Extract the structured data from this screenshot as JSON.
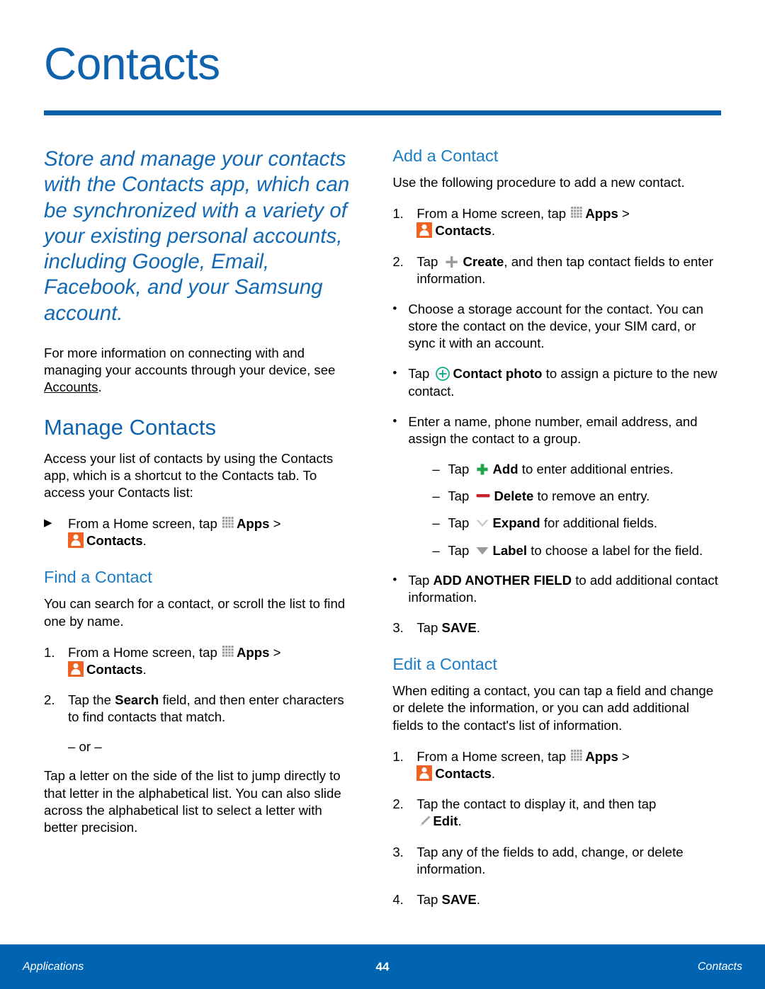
{
  "page_title": "Contacts",
  "colors": {
    "heading_blue": "#0F62AC",
    "rule_blue": "#0B5FAA",
    "subheading_blue": "#1B7CC4",
    "lead_blue": "#1268B3",
    "footer_blue": "#0064B0",
    "contacts_icon_orange": "#EE6324",
    "add_icon_green": "#21A349",
    "delete_icon_red": "#C8232C",
    "contact_photo_teal": "#16A88C",
    "icon_grey": "#9A9A9A"
  },
  "lead": "Store and manage your contacts with the Contacts app, which can be synchronized with a variety of your existing personal accounts, including Google, Email, Facebook, and your Samsung account.",
  "intro": {
    "text_before_link": "For more information on connecting with and managing your accounts through your device, see ",
    "link": "Accounts",
    "text_after_link": "."
  },
  "left_column": {
    "manage": {
      "heading": "Manage Contacts",
      "body": "Access your list of contacts by using the Contacts app, which is a shortcut to the Contacts tab. To access your Contacts list:",
      "step_arrow": "▶",
      "step_text_1": "From a Home screen, tap ",
      "apps_label": "Apps",
      "chevron": " > ",
      "contacts_label": "Contacts",
      "period": "."
    },
    "find": {
      "heading": "Find a Contact",
      "body": "You can search for a contact, or scroll the list to find one by name.",
      "steps": [
        {
          "num": "1.",
          "pre": "From a Home screen, tap ",
          "apps_label": "Apps",
          "chevron": " > ",
          "contacts_label": "Contacts",
          "post": "."
        },
        {
          "num": "2.",
          "pre": "Tap the ",
          "bold": "Search",
          "post": " field, and then enter characters to find contacts that match."
        }
      ],
      "or_separator": "– or –",
      "alt_text": "Tap a letter on the side of the list to jump directly to that letter in the alphabetical list. You can also slide across the alphabetical list to select a letter with better precision."
    }
  },
  "right_column": {
    "add": {
      "heading": "Add a Contact",
      "body": "Use the following procedure to add a new contact.",
      "step1": {
        "num": "1.",
        "pre": "From a Home screen, tap ",
        "apps_label": "Apps",
        "chevron": " > ",
        "contacts_label": "Contacts",
        "post": "."
      },
      "step2": {
        "num": "2.",
        "pre": "Tap ",
        "bold": "Create",
        "post": ", and then tap contact fields to enter information."
      },
      "bullets": [
        {
          "text": "Choose a storage account for the contact. You can store the contact on the device, your SIM card, or sync it with an account."
        },
        {
          "pre": "Tap ",
          "bold": "Contact photo",
          "post": " to assign a picture to the new contact."
        },
        {
          "text": "Enter a name, phone number, email address, and assign the contact to a group."
        }
      ],
      "dashes": [
        {
          "pre": "Tap ",
          "bold": "Add",
          "post": " to enter additional entries."
        },
        {
          "pre": "Tap ",
          "bold": "Delete",
          "post": " to remove an entry."
        },
        {
          "pre": "Tap ",
          "bold": "Expand",
          "post": " for additional fields."
        },
        {
          "pre": "Tap ",
          "bold": "Label",
          "post": " to choose a label for the field."
        }
      ],
      "last_bullet": {
        "pre": "Tap ",
        "bold": "ADD ANOTHER FIELD",
        "post": " to add additional contact information."
      },
      "step3": {
        "num": "3.",
        "pre": "Tap ",
        "bold": "SAVE",
        "post": "."
      }
    },
    "edit": {
      "heading": "Edit a Contact",
      "body": "When editing a contact, you can tap a field and change or delete the information, or you can add additional fields to the contact's list of information.",
      "steps": [
        {
          "num": "1.",
          "pre": "From a Home screen, tap ",
          "apps_label": "Apps",
          "chevron": " > ",
          "contacts_label": "Contacts",
          "post": "."
        },
        {
          "num": "2.",
          "pre": "Tap the contact to display it, and then tap ",
          "bold": "Edit",
          "post": "."
        },
        {
          "num": "3.",
          "pre": "Tap any of the fields to add, change, or delete information.",
          "bold": "",
          "post": ""
        },
        {
          "num": "4.",
          "pre": "Tap ",
          "bold": "SAVE",
          "post": "."
        }
      ]
    }
  },
  "footer": {
    "left": "Applications",
    "page_number": "44",
    "right": "Contacts"
  }
}
